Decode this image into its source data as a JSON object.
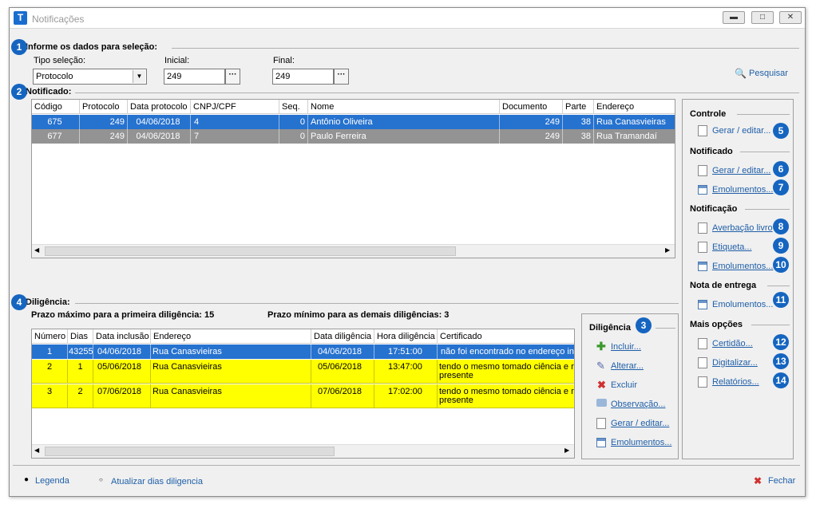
{
  "window": {
    "title": "Notificações",
    "icon_letter": "T"
  },
  "selection": {
    "section_title": "Informe os dados para seleção:",
    "tipo_label": "Tipo seleção:",
    "tipo_value": "Protocolo",
    "inicial_label": "Inicial:",
    "inicial_value": "249",
    "final_label": "Final:",
    "final_value": "249",
    "ellipsis": "···",
    "search_label": "Pesquisar"
  },
  "notificado": {
    "section_title": "Notificado:",
    "columns": [
      "Código",
      "Protocolo",
      "Data protocolo",
      "CNPJ/CPF",
      "Seq.",
      "Nome",
      "Documento",
      "Parte",
      "Endereço"
    ],
    "rows": [
      {
        "codigo": "675",
        "protocolo": "249",
        "data": "04/06/2018",
        "cnpj": "4",
        "seq": "0",
        "nome": "Antônio Oliveira",
        "documento": "249",
        "parte": "38",
        "endereco": "Rua Canasvieiras"
      },
      {
        "codigo": "677",
        "protocolo": "249",
        "data": "04/06/2018",
        "cnpj": "7",
        "seq": "0",
        "nome": "Paulo Ferreira",
        "documento": "249",
        "parte": "38",
        "endereco": "Rua Tramandaí"
      }
    ]
  },
  "diligencia": {
    "section_title": "Diligência:",
    "prazo_max": "Prazo máximo para a primeira diligência: 15",
    "prazo_min": "Prazo mínimo para as demais diligências: 3",
    "columns": [
      "Número",
      "Dias",
      "Data inclusão",
      "Endereço",
      "Data diligência",
      "Hora diligência",
      "Certificado"
    ],
    "rows": [
      {
        "numero": "1",
        "dias": "43255",
        "data_inclusao": "04/06/2018",
        "endereco": "Rua Canasvieiras",
        "data_dil": "04/06/2018",
        "hora": "17:51:00",
        "cert1": "não foi encontrado no endereço ind",
        "cert2": ""
      },
      {
        "numero": "2",
        "dias": "1",
        "data_inclusao": "05/06/2018",
        "endereco": "Rua Canasvieiras",
        "data_dil": "05/06/2018",
        "hora": "13:47:00",
        "cert1": " tendo o mesmo tomado ciência e re",
        "cert2": "presente"
      },
      {
        "numero": "3",
        "dias": "2",
        "data_inclusao": "07/06/2018",
        "endereco": "Rua Canasvieiras",
        "data_dil": "07/06/2018",
        "hora": "17:02:00",
        "cert1": " tendo o mesmo tomado ciência e re",
        "cert2": "presente"
      }
    ],
    "panel_title": "Diligência",
    "actions": [
      "Incluir...",
      "Alterar...",
      "Excluir",
      "Observação...",
      "Gerar / editar...",
      "Emolumentos..."
    ]
  },
  "right_panel": {
    "controle": {
      "title": "Controle",
      "items": [
        "Gerar / editar..."
      ]
    },
    "notificado": {
      "title": "Notificado",
      "items": [
        "Gerar / editar...",
        "Emolumentos..."
      ]
    },
    "notificacao": {
      "title": "Notificação",
      "items": [
        "Averbação livro",
        "Etiqueta...",
        "Emolumentos..."
      ]
    },
    "nota": {
      "title": "Nota de entrega",
      "items": [
        "Emolumentos..."
      ]
    },
    "mais": {
      "title": "Mais opções",
      "items": [
        "Certidão...",
        "Digitalizar...",
        "Relatórios..."
      ]
    }
  },
  "badges": [
    "1",
    "2",
    "3",
    "4",
    "5",
    "6",
    "7",
    "8",
    "9",
    "10",
    "11",
    "12",
    "13",
    "14"
  ],
  "footer": {
    "legenda": "Legenda",
    "atualizar": "Atualizar dias diligencia",
    "fechar": "Fechar"
  }
}
